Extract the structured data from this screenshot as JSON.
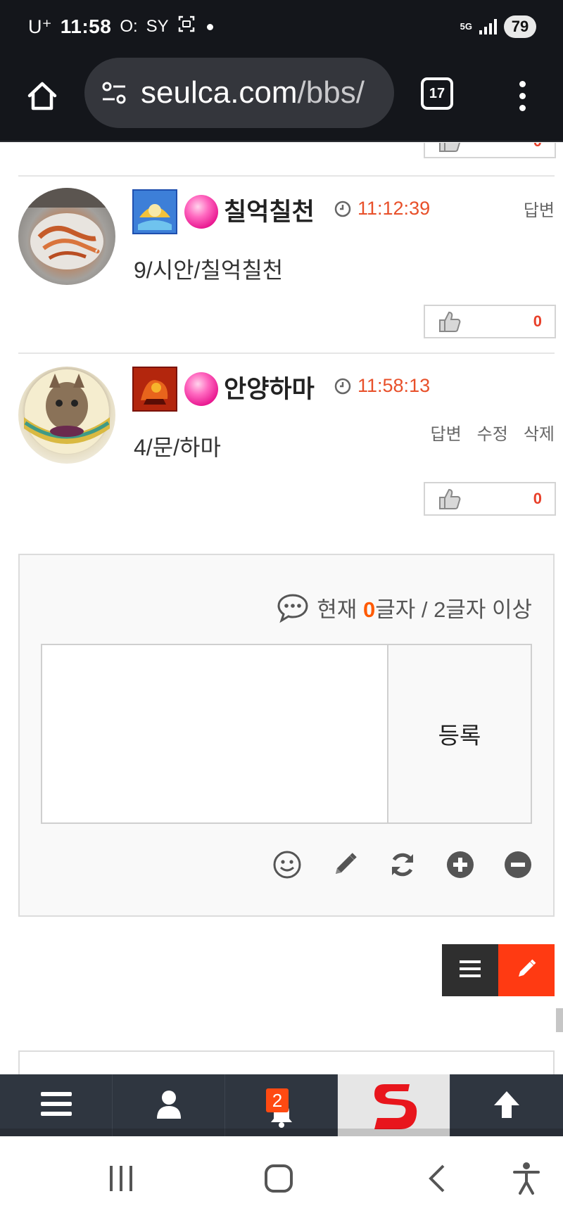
{
  "status_bar": {
    "carrier": "U⁺",
    "time": "11:58",
    "indicator_1": "O:",
    "indicator_2": "SY",
    "network": "5G",
    "battery": "79"
  },
  "browser": {
    "url_host": "seulca.com",
    "url_path": "/bbs/",
    "tab_count": "17"
  },
  "comments": [
    {
      "nickname": "칠억칠천",
      "time": "11:12:39",
      "text": "9/시안/칠억칠천",
      "actions": [
        "답변"
      ],
      "likes": "0"
    },
    {
      "nickname": "안양하마",
      "time": "11:58:13",
      "text": "4/문/하마",
      "actions": [
        "답변",
        "수정",
        "삭제"
      ],
      "likes": "0"
    }
  ],
  "previous_like_count": "0",
  "form": {
    "counter_prefix": "현재 ",
    "counter_value": "0",
    "counter_suffix": "글자 / 2글자 이상",
    "textarea_value": "",
    "submit_label": "등록"
  },
  "site_nav": {
    "notification_count": "2"
  },
  "icons": {
    "home": "home-icon",
    "tune": "site-settings-icon",
    "menu": "more-vert-icon",
    "thumb": "thumbs-up-icon",
    "clock": "clock-icon",
    "bubble": "comment-bubble-icon",
    "emoji": "smiley-icon",
    "pencil": "pencil-icon",
    "refresh": "refresh-icon",
    "plus": "plus-circle-icon",
    "minus": "minus-circle-icon",
    "list": "list-icon",
    "user": "user-icon",
    "bell": "bell-icon",
    "logo": "seulca-logo",
    "up": "arrow-up-icon"
  },
  "colors": {
    "accent": "#ff3a12",
    "time": "#e8502a",
    "like": "#e8402a",
    "nav_bg": "#2f3640"
  }
}
